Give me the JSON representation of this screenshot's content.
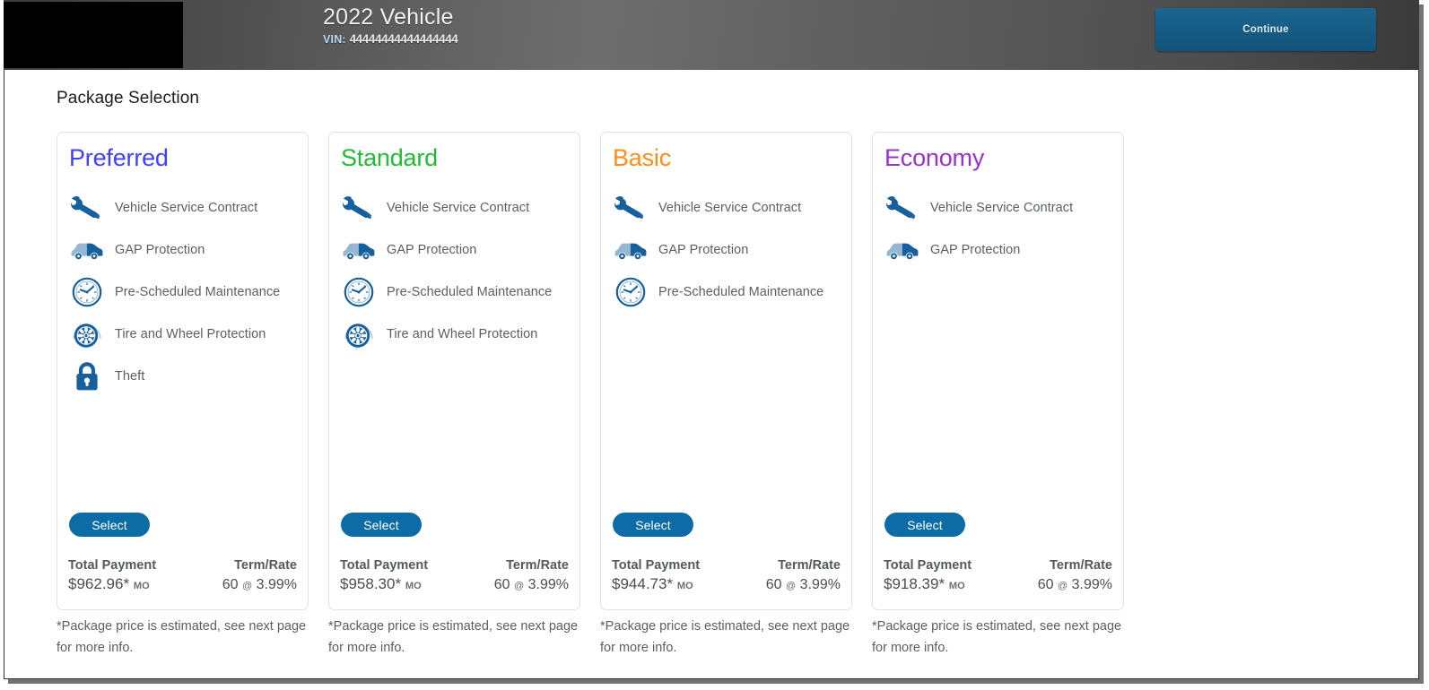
{
  "header": {
    "logo": "dealer-logo-placeholder",
    "vehicle_year": "2022",
    "vehicle_name": "Vehicle",
    "vin_label": "VIN:",
    "vin_value": "44444444444444444",
    "continue_label": "Continue",
    "continue_color": "#155a84"
  },
  "main": {
    "page_title": "Package Selection"
  },
  "labels": {
    "total_payment": "Total Payment",
    "term_rate": "Term/Rate",
    "select": "Select",
    "mo_suffix": "MO",
    "at_symbol": "@",
    "footnote": "*Package price is estimated, see next page for more info."
  },
  "icon_colors": {
    "feature_icon": "#16609e",
    "select_button": "#0d6ca6"
  },
  "packages": [
    {
      "name": "Preferred",
      "color": "#4040ff",
      "features": [
        {
          "icon": "wrench-icon",
          "label": "Vehicle Service Contract"
        },
        {
          "icon": "car-icon",
          "label": "GAP Protection"
        },
        {
          "icon": "clock-icon",
          "label": "Pre-Scheduled Maintenance"
        },
        {
          "icon": "tire-wheel-icon",
          "label": "Tire and Wheel Protection"
        },
        {
          "icon": "lock-icon",
          "label": "Theft"
        }
      ],
      "total_payment": "$962.96*",
      "term": "60",
      "rate": "3.99%"
    },
    {
      "name": "Standard",
      "color": "#22bb33",
      "features": [
        {
          "icon": "wrench-icon",
          "label": "Vehicle Service Contract"
        },
        {
          "icon": "car-icon",
          "label": "GAP Protection"
        },
        {
          "icon": "clock-icon",
          "label": "Pre-Scheduled Maintenance"
        },
        {
          "icon": "tire-wheel-icon",
          "label": "Tire and Wheel Protection"
        }
      ],
      "total_payment": "$958.30*",
      "term": "60",
      "rate": "3.99%"
    },
    {
      "name": "Basic",
      "color": "#ff8c1a",
      "features": [
        {
          "icon": "wrench-icon",
          "label": "Vehicle Service Contract"
        },
        {
          "icon": "car-icon",
          "label": "GAP Protection"
        },
        {
          "icon": "clock-icon",
          "label": "Pre-Scheduled Maintenance"
        }
      ],
      "total_payment": "$944.73*",
      "term": "60",
      "rate": "3.99%"
    },
    {
      "name": "Economy",
      "color": "#9932cc",
      "features": [
        {
          "icon": "wrench-icon",
          "label": "Vehicle Service Contract"
        },
        {
          "icon": "car-icon",
          "label": "GAP Protection"
        }
      ],
      "total_payment": "$918.39*",
      "term": "60",
      "rate": "3.99%"
    }
  ]
}
